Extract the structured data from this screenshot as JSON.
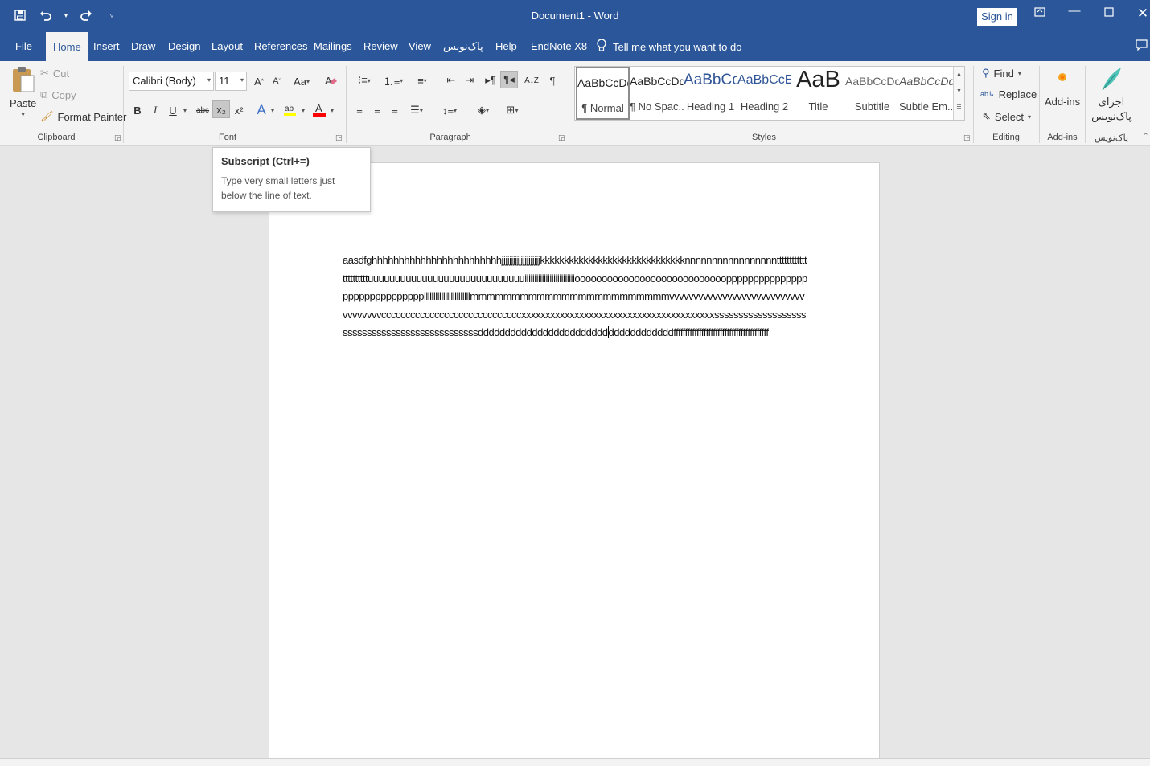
{
  "window": {
    "title": "Document1  -  Word",
    "sign_in": "Sign in"
  },
  "qat": {
    "save_icon": "save-icon",
    "undo_icon": "undo-icon",
    "redo_icon": "redo-icon",
    "customize_icon": "customize-qat-icon"
  },
  "tabs": [
    "File",
    "Home",
    "Insert",
    "Draw",
    "Design",
    "Layout",
    "References",
    "Mailings",
    "Review",
    "View",
    "پاک‌نویس",
    "Help",
    "EndNote X8"
  ],
  "active_tab": "Home",
  "tell_me": "Tell me what you want to do",
  "clipboard": {
    "paste": "Paste",
    "cut": "Cut",
    "copy": "Copy",
    "format_painter": "Format Painter",
    "label": "Clipboard"
  },
  "font": {
    "family": "Calibri (Body)",
    "size": "11",
    "label": "Font",
    "bold": "B",
    "italic": "I",
    "underline": "U",
    "strike": "abc",
    "subscript": "x₂",
    "superscript": "x²",
    "grow": "A",
    "shrink": "A",
    "case": "Aa",
    "text_effects": "A",
    "font_color": "A"
  },
  "paragraph": {
    "label": "Paragraph"
  },
  "styles": {
    "label": "Styles",
    "items": [
      {
        "preview": "AaBbCcDd",
        "name": "¶ Normal"
      },
      {
        "preview": "AaBbCcDd",
        "name": "¶ No Spac..."
      },
      {
        "preview": "AaBbCc",
        "name": "Heading 1"
      },
      {
        "preview": "AaBbCcE",
        "name": "Heading 2"
      },
      {
        "preview": "AaB",
        "name": "Title"
      },
      {
        "preview": "AaBbCcDd",
        "name": "Subtitle"
      },
      {
        "preview": "AaBbCcDd",
        "name": "Subtle Em..."
      }
    ]
  },
  "editing": {
    "find": "Find",
    "replace": "Replace",
    "select": "Select",
    "label": "Editing"
  },
  "addins": {
    "button": "Add-ins",
    "label": "Add-ins"
  },
  "paknevis": {
    "button_line1": "اجرای",
    "button_line2": "پاک‌نویس",
    "label": "پاک‌نویس"
  },
  "tooltip": {
    "title": "Subscript (Ctrl+=)",
    "description": "Type very small letters just below the line of text."
  },
  "document": {
    "text_before_cursor": "aasdfghhhhhhhhhhhhhhhhhhhhhhhhjjjjjjjjjjjjjjjjjjjjkkkkkkkkkkkkkkkkkkkkkkkkkkkkkknnnnnnnnnnnnnnnnnttttttttttttttttttttttuuuuuuuuuuuuuuuuuuuuuuuuuuuuuiiiiiiiiiiiiiiiiiiiiiiiiiiooooooooooooooooooooooooooooppppppppppppppppppppppppppppppllllllllllllllllllllllllmmmmmmmmmmmmmmmmmmmmmmmmvvvvvvvvvvvvvvvvvvvvvvvvvvvvvvvvvvvvcccccccccccccccccccccccccccccxxxxxxxxxxxxxxxxxxxxxxxxxxxxxxxxxxxxxxxxsssssssssssssssssssssssssssssssssssssssssssssssdddddddddddddddddddddddd",
    "text_after_cursor": "ddddddddddddfffffffffffffffffffffffffffffffffffffffff"
  },
  "colors": {
    "accent": "#2b579a",
    "highlight": "#ffff00",
    "font_color": "#ff0000"
  }
}
